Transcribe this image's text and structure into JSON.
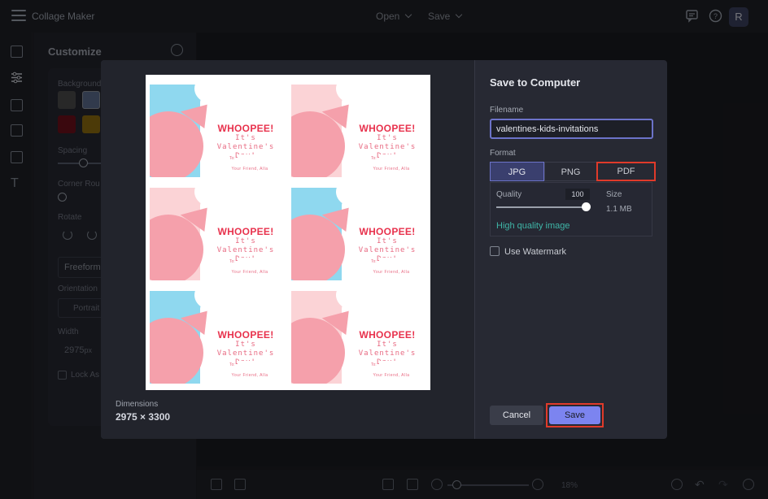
{
  "app": {
    "title": "Collage Maker",
    "avatar_letter": "R"
  },
  "topbar": {
    "open_label": "Open",
    "save_label": "Save"
  },
  "left_rail": {
    "icons": [
      "layout-icon",
      "adjust-icon",
      "grid-icon",
      "layers-icon",
      "elements-icon",
      "text-icon"
    ]
  },
  "customize": {
    "title": "Customize",
    "background_label": "Background",
    "spacing_label": "Spacing",
    "corner_label": "Corner Rou",
    "rotate_label": "Rotate",
    "freeform_label": "Freeform",
    "orientation_label": "Orientation",
    "portrait_label": "Portrait",
    "width_label": "Width",
    "width_value": "2975",
    "width_unit": "px",
    "lock_label": "Lock As",
    "swatches": [
      "#4a4a4a",
      "#5a6a8a",
      "#6b0f1a",
      "#8a6a10"
    ]
  },
  "bottombar": {
    "zoom": "18%"
  },
  "dialog": {
    "title": "Save to Computer",
    "filename_label": "Filename",
    "filename_value": "valentines-kids-invitations",
    "format_label": "Format",
    "formats": [
      "JPG",
      "PNG",
      "PDF"
    ],
    "selected_format": "JPG",
    "quality_label": "Quality",
    "quality_value": "100",
    "size_label": "Size",
    "size_value": "1.1 MB",
    "high_quality_link": "High quality image",
    "watermark_label": "Use Watermark",
    "cancel_label": "Cancel",
    "save_label": "Save",
    "dimensions_label": "Dimensions",
    "dimensions_value": "2975 × 3300"
  },
  "invitation": {
    "headline": "WHOOPEE!",
    "line1": "It's Valentine's",
    "line2": "Day!",
    "to_label": "To:",
    "from_text": "Your Friend, Alla"
  },
  "cards": [
    {
      "bg": "#8fd8ef",
      "circle": "#f5a0ab"
    },
    {
      "bg": "#fbd3d6",
      "circle": "#f5a0ab"
    },
    {
      "bg": "#fbd3d6",
      "circle": "#f5a0ab"
    },
    {
      "bg": "#8fd8ef",
      "circle": "#f5a0ab"
    },
    {
      "bg": "#8fd8ef",
      "circle": "#f5a0ab"
    },
    {
      "bg": "#fbd3d6",
      "circle": "#f5a0ab"
    }
  ],
  "colors": {
    "accent": "#7c84f0",
    "highlight": "#e03a2a",
    "link": "#3fb6a8"
  }
}
